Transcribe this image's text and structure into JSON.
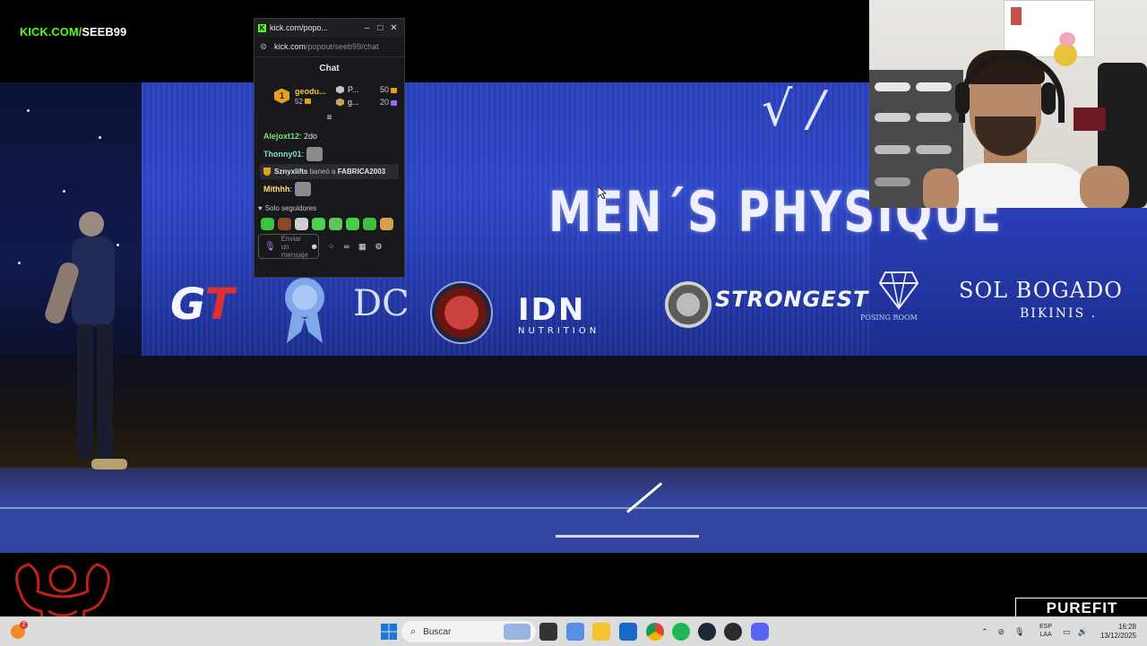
{
  "overlay": {
    "channel_prefix": "KICK.COM/",
    "channel_name": "SEEB99",
    "brand_right": "PUREFIT"
  },
  "stream": {
    "screen_title": "MEN´S PHYSIQUE",
    "sponsors": {
      "gt": "G",
      "gt_t": "T",
      "dc": "DC",
      "idn": "IDN",
      "idn_sub": "NUTRITION",
      "strongest": "STRONGEST",
      "posing_room": "POSING ROOM",
      "sol_bogado": "SOL BOGADO",
      "bikinis": "BIKINIS ."
    }
  },
  "chat_window": {
    "title": "kick.com/popo...",
    "url_host": "kick.com",
    "url_path": "/popout/seeb99/chat",
    "heading": "Chat",
    "leaderboard": {
      "first": {
        "rank": "1",
        "name": "geodu...",
        "value": "52"
      },
      "others": [
        {
          "name": "P...",
          "value": "50",
          "coin": "gold"
        },
        {
          "name": "g...",
          "value": "20",
          "coin": "purple"
        }
      ]
    },
    "messages": [
      {
        "user": "Alejoxt12",
        "color": "#7ee07e",
        "text": ": 2do",
        "emote": false
      },
      {
        "user": "Thonny01",
        "color": "#7ee0c9",
        "text": ":",
        "emote": true
      },
      {
        "user": "Mithhh",
        "color": "#ffe066",
        "text": ":",
        "emote": true
      }
    ],
    "mod_notice": {
      "actor": "Sznyxlifts",
      "action": "baneó a",
      "target": "FABRICA2003"
    },
    "followers_only": "Solo seguidores",
    "input_placeholder": "Enviar un mensaje",
    "input_emoji": "☻",
    "icons": {
      "minimize": "–",
      "maximize": "□",
      "close": "✕",
      "site_settings": "⚙",
      "collapse": "≡",
      "mic": "🎙",
      "extras": "⁘",
      "infinity": "∞",
      "store": "▦",
      "settings": "⚙"
    }
  },
  "taskbar": {
    "search_placeholder": "Buscar",
    "badge": "2",
    "lang_top": "ESP",
    "lang_bottom": "LAA",
    "time": "16:28",
    "date": "13/12/2025"
  },
  "colors": {
    "kick_green": "#53fc18",
    "gold": "#e3a21a"
  }
}
